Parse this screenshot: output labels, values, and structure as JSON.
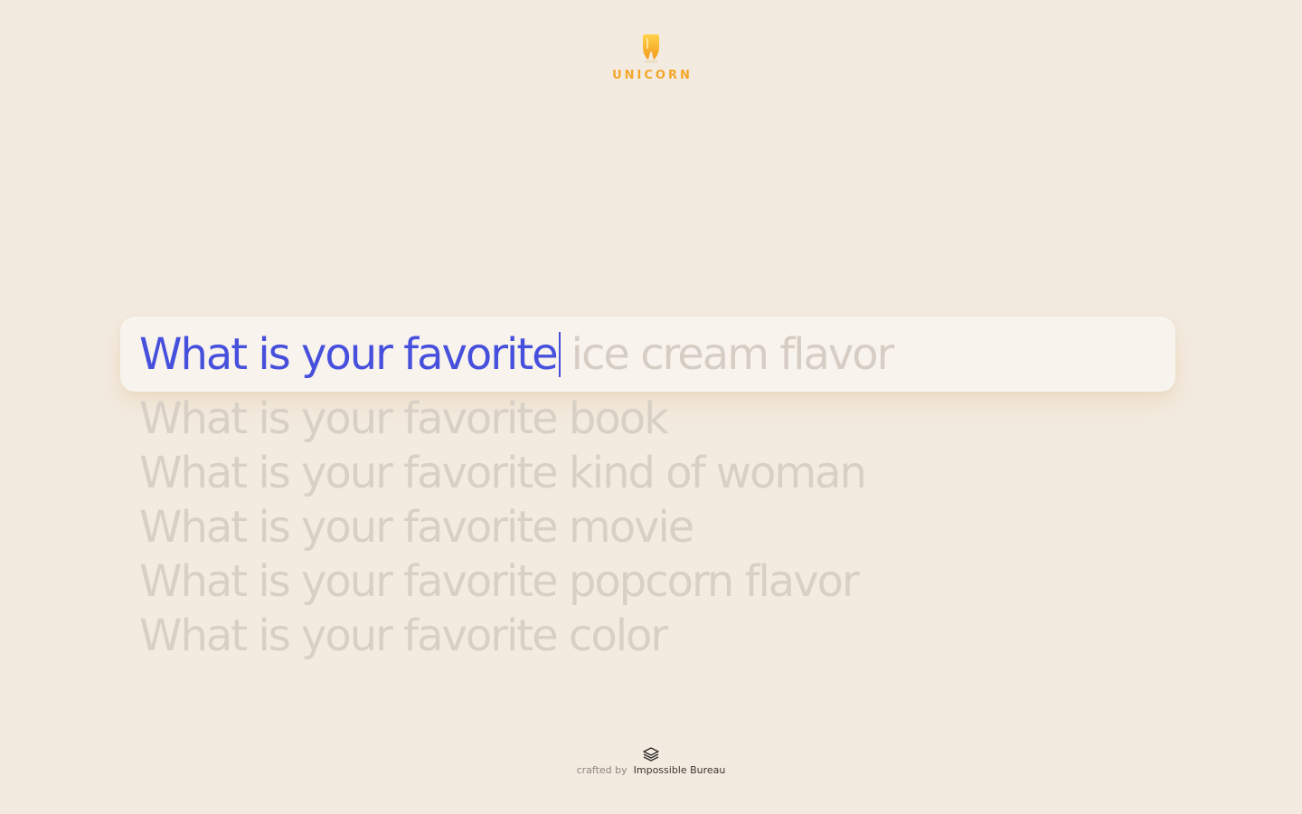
{
  "logo": {
    "icon": "unicorn-tooth-icon",
    "text": "UNICORN",
    "color": "#f4a62a"
  },
  "search": {
    "typed": "What is your favorite",
    "completion": "ice cream flavor",
    "typed_color": "#4650dd"
  },
  "suggestions": [
    "What is your favorite book",
    "What is your favorite kind of woman",
    "What is your favorite movie",
    "What is your favorite popcorn flavor",
    "What is your favorite color"
  ],
  "footer": {
    "icon": "layers-icon",
    "crafted_by": "crafted by",
    "brand": "Impossible Bureau"
  }
}
